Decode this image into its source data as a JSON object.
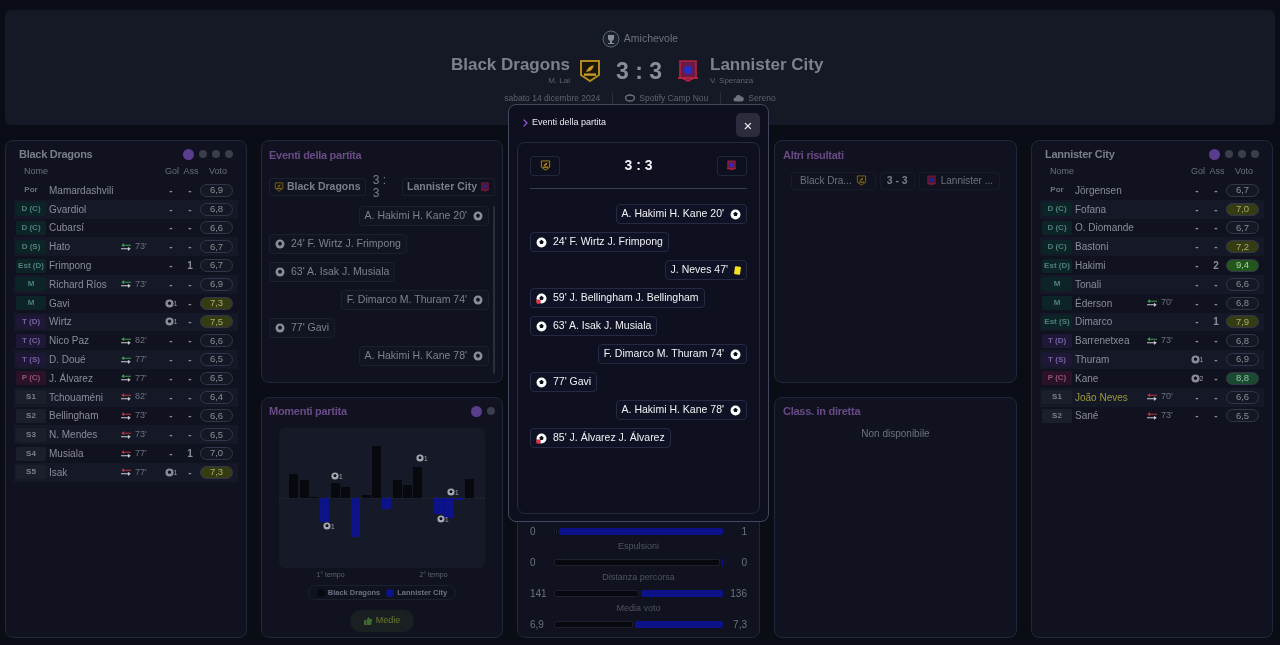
{
  "header": {
    "competition": "Amichevole",
    "home": {
      "name": "Black Dragons",
      "coach": "M. Lai"
    },
    "score": "3 : 3",
    "away": {
      "name": "Lannister City",
      "coach": "V. Speranza"
    },
    "date": "sabato 14 dicembre 2024",
    "stadium": "Spotify Camp Nou",
    "weather": "Sereno"
  },
  "home_lineup": {
    "title": "Black Dragons",
    "pages": [
      {
        "selected": true
      },
      {
        "selected": false
      },
      {
        "selected": false
      },
      {
        "selected": false
      }
    ],
    "columns": [
      "Nome",
      "Gol",
      "Ass",
      "Voto"
    ],
    "players": [
      {
        "pos": "Por",
        "kind": "gk",
        "name": "Mamardashvili",
        "goals": "-",
        "scored": false,
        "assists": "-",
        "rating": "6,9",
        "color": "#141724",
        "booked": false
      },
      {
        "pos": "D (C)",
        "kind": "def",
        "name": "Gvardiol",
        "goals": "-",
        "scored": false,
        "assists": "-",
        "rating": "6,8",
        "color": "#141724",
        "booked": false
      },
      {
        "pos": "D (C)",
        "kind": "def",
        "name": "Cubarsí",
        "goals": "-",
        "scored": false,
        "assists": "-",
        "rating": "6,6",
        "color": "#141724",
        "booked": false
      },
      {
        "pos": "D (S)",
        "kind": "def",
        "name": "Hato",
        "sub": {
          "kind": "off",
          "minute": "73'"
        },
        "goals": "-",
        "scored": false,
        "assists": "-",
        "rating": "6,7",
        "color": "#141724",
        "booked": false
      },
      {
        "pos": "Est (D)",
        "kind": "def",
        "name": "Frimpong",
        "goals": "-",
        "scored": false,
        "assists": "1",
        "rating": "6,7",
        "color": "#141724",
        "booked": false
      },
      {
        "pos": "M",
        "kind": "mid",
        "name": "Richard Ríos",
        "sub": {
          "kind": "off",
          "minute": "73'"
        },
        "goals": "-",
        "scored": false,
        "assists": "-",
        "rating": "6,9",
        "color": "#141724",
        "booked": false
      },
      {
        "pos": "M",
        "kind": "mid",
        "name": "Gavi",
        "goals": "1",
        "scored": true,
        "assists": "-",
        "rating": "7,3",
        "color": "#353c14",
        "booked": false
      },
      {
        "pos": "T (D)",
        "kind": "att",
        "name": "Wirtz",
        "goals": "1",
        "scored": true,
        "assists": "-",
        "rating": "7,5",
        "color": "#353c14",
        "booked": false
      },
      {
        "pos": "T (C)",
        "kind": "att",
        "name": "Nico Paz",
        "sub": {
          "kind": "off",
          "minute": "82'"
        },
        "goals": "-",
        "scored": false,
        "assists": "-",
        "rating": "6,6",
        "color": "#141724",
        "booked": false
      },
      {
        "pos": "T (S)",
        "kind": "att",
        "name": "D. Doué",
        "sub": {
          "kind": "off",
          "minute": "77'"
        },
        "goals": "-",
        "scored": false,
        "assists": "-",
        "rating": "6,5",
        "color": "#141724",
        "booked": false
      },
      {
        "pos": "P (C)",
        "kind": "fwd",
        "name": "J. Álvarez",
        "sub": {
          "kind": "off",
          "minute": "77'"
        },
        "goals": "-",
        "scored": false,
        "assists": "-",
        "rating": "6,5",
        "color": "#141724",
        "booked": false
      },
      {
        "pos": "S1",
        "kind": "sub",
        "name": "Tchouaméni",
        "sub": {
          "kind": "on",
          "minute": "82'"
        },
        "goals": "-",
        "scored": false,
        "assists": "-",
        "rating": "6,4",
        "color": "#141724",
        "booked": false
      },
      {
        "pos": "S2",
        "kind": "sub",
        "name": "Bellingham",
        "sub": {
          "kind": "on",
          "minute": "73'"
        },
        "goals": "-",
        "scored": false,
        "assists": "-",
        "rating": "6,6",
        "color": "#141724",
        "booked": false
      },
      {
        "pos": "S3",
        "kind": "sub",
        "name": "N. Mendes",
        "sub": {
          "kind": "on",
          "minute": "73'"
        },
        "goals": "-",
        "scored": false,
        "assists": "-",
        "rating": "6,5",
        "color": "#141724",
        "booked": false
      },
      {
        "pos": "S4",
        "kind": "sub",
        "name": "Musiala",
        "sub": {
          "kind": "on",
          "minute": "77'"
        },
        "goals": "-",
        "scored": false,
        "assists": "1",
        "rating": "7,0",
        "color": "#141724",
        "booked": false
      },
      {
        "pos": "S5",
        "kind": "sub",
        "name": "Isak",
        "sub": {
          "kind": "on",
          "minute": "77'"
        },
        "goals": "1",
        "scored": true,
        "assists": "-",
        "rating": "7,3",
        "color": "#353c14",
        "booked": false
      }
    ]
  },
  "events_panel": {
    "title": "Eventi della partita",
    "home": "Black Dragons",
    "score": "3 : 3",
    "away": "Lannister City",
    "events": [
      {
        "away": true,
        "kind": "goal",
        "text": "A. Hakimi H. Kane 20'"
      },
      {
        "away": false,
        "kind": "goal",
        "text": "24' F. Wirtz J. Frimpong"
      },
      {
        "away": false,
        "kind": "goal",
        "text": "63' A. Isak J. Musiala"
      },
      {
        "away": true,
        "kind": "goal",
        "text": "F. Dimarco M. Thuram 74'"
      },
      {
        "away": false,
        "kind": "goal",
        "text": "77' Gavi"
      },
      {
        "away": true,
        "kind": "goal",
        "text": "A. Hakimi H. Kane 78'"
      }
    ]
  },
  "momentum_panel": {
    "title": "Momenti partita",
    "pages": [
      {
        "selected": true
      },
      {
        "selected": false
      }
    ],
    "goal_marks": [
      "1",
      "1",
      "1",
      "1",
      "1"
    ],
    "halves": [
      "1° tempo",
      "2° tempo"
    ],
    "legend": [
      {
        "name": "Black Dragons",
        "color": "#07090e"
      },
      {
        "name": "Lannister City",
        "color": "#0c1288"
      }
    ],
    "button": "Medie"
  },
  "stats_panel": {
    "rows": [
      {
        "home": "0",
        "away": "1",
        "level": 0.02
      },
      {
        "label": "Espulsioni",
        "home": "0",
        "away": "0",
        "level": 0.98
      },
      {
        "label": "Distanza percorsa",
        "home": "141",
        "away": "136",
        "level": 0.5
      },
      {
        "label": "Media voto",
        "home": "6,9",
        "away": "7,3",
        "level": 0.47
      }
    ]
  },
  "other_results": {
    "title": "Altri risultati",
    "home": "Black Dra...",
    "score": "3 - 3",
    "away": "Lannister ..."
  },
  "live_table": {
    "title": "Class. in diretta",
    "message": "Non disponibile"
  },
  "away_lineup": {
    "title": "Lannister City",
    "pages": [
      {
        "selected": true
      },
      {
        "selected": false
      },
      {
        "selected": false
      },
      {
        "selected": false
      }
    ],
    "columns": [
      "Nome",
      "Gol",
      "Ass",
      "Voto"
    ],
    "players": [
      {
        "pos": "Por",
        "kind": "gk",
        "name": "Jörgensen",
        "goals": "-",
        "scored": false,
        "assists": "-",
        "rating": "6,7",
        "color": "#141724",
        "booked": false
      },
      {
        "pos": "D (C)",
        "kind": "def",
        "name": "Fofana",
        "goals": "-",
        "scored": false,
        "assists": "-",
        "rating": "7,0",
        "color": "#353c14",
        "booked": false
      },
      {
        "pos": "D (C)",
        "kind": "def",
        "name": "O. Diomande",
        "goals": "-",
        "scored": false,
        "assists": "-",
        "rating": "6,7",
        "color": "#141724",
        "booked": false
      },
      {
        "pos": "D (C)",
        "kind": "def",
        "name": "Bastoni",
        "goals": "-",
        "scored": false,
        "assists": "-",
        "rating": "7,2",
        "color": "#353c14",
        "booked": false
      },
      {
        "pos": "Est (D)",
        "kind": "def",
        "name": "Hakimi",
        "goals": "-",
        "scored": false,
        "assists": "2",
        "rating": "9,4",
        "color": "#22561c",
        "booked": false
      },
      {
        "pos": "M",
        "kind": "mid",
        "name": "Tonali",
        "goals": "-",
        "scored": false,
        "assists": "-",
        "rating": "6,6",
        "color": "#141724",
        "booked": false
      },
      {
        "pos": "M",
        "kind": "mid",
        "name": "Éderson",
        "sub": {
          "kind": "off",
          "minute": "70'"
        },
        "goals": "-",
        "scored": false,
        "assists": "-",
        "rating": "6,8",
        "color": "#141724",
        "booked": false
      },
      {
        "pos": "Est (S)",
        "kind": "def",
        "name": "Dimarco",
        "goals": "-",
        "scored": false,
        "assists": "1",
        "rating": "7,9",
        "color": "#353c14",
        "booked": false
      },
      {
        "pos": "T (D)",
        "kind": "att",
        "name": "Barrenetxea",
        "sub": {
          "kind": "off",
          "minute": "73'"
        },
        "goals": "-",
        "scored": false,
        "assists": "-",
        "rating": "6,8",
        "color": "#141724",
        "booked": false
      },
      {
        "pos": "T (S)",
        "kind": "att",
        "name": "Thuram",
        "goals": "1",
        "scored": true,
        "assists": "-",
        "rating": "6,9",
        "color": "#141724",
        "booked": false
      },
      {
        "pos": "P (C)",
        "kind": "fwd",
        "name": "Kane",
        "goals": "2",
        "scored": true,
        "assists": "-",
        "rating": "8,8",
        "color": "#1a4a30",
        "booked": false
      },
      {
        "pos": "S1",
        "kind": "sub",
        "name": "João Neves",
        "sub": {
          "kind": "on",
          "minute": "70'"
        },
        "goals": "-",
        "scored": false,
        "assists": "-",
        "rating": "6,6",
        "color": "#141724",
        "booked": true
      },
      {
        "pos": "S2",
        "kind": "sub",
        "name": "Sané",
        "sub": {
          "kind": "on",
          "minute": "73'"
        },
        "goals": "-",
        "scored": false,
        "assists": "-",
        "rating": "6,5",
        "color": "#141724",
        "booked": false
      }
    ]
  },
  "modal": {
    "title": "Eventi della partita",
    "close": "×",
    "score": "3 : 3",
    "events": [
      {
        "away": true,
        "kind": "goal",
        "text": "A. Hakimi H. Kane 20'"
      },
      {
        "away": false,
        "kind": "goal",
        "text": "24' F. Wirtz J. Frimpong"
      },
      {
        "away": true,
        "kind": "yellow_card",
        "text": "J. Neves 47'"
      },
      {
        "away": false,
        "kind": "own_goal",
        "text": "59' J. Bellingham J. Bellingham"
      },
      {
        "away": false,
        "kind": "goal",
        "text": "63' A. Isak J. Musiala"
      },
      {
        "away": true,
        "kind": "goal",
        "text": "F. Dimarco M. Thuram 74'"
      },
      {
        "away": false,
        "kind": "goal",
        "text": "77' Gavi"
      },
      {
        "away": true,
        "kind": "goal",
        "text": "A. Hakimi H. Kane 78'"
      },
      {
        "away": false,
        "kind": "own_goal",
        "text": "85' J. Álvarez J. Álvarez"
      }
    ]
  }
}
